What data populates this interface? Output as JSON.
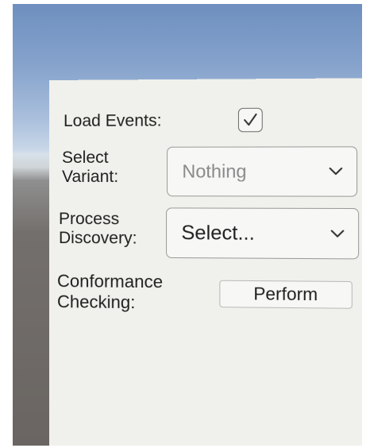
{
  "panel": {
    "load_events": {
      "label": "Load Events:",
      "checked": true,
      "check_icon": "checkmark-icon"
    },
    "select_variant": {
      "label": "Select\nVariant:",
      "value": "Nothing",
      "chevron_icon": "chevron-down-icon"
    },
    "process_discovery": {
      "label": "Process\nDiscovery:",
      "value": "Select...",
      "chevron_icon": "chevron-down-icon"
    },
    "conformance_checking": {
      "label": "Conformance\nChecking:",
      "button_label": "Perform"
    }
  }
}
